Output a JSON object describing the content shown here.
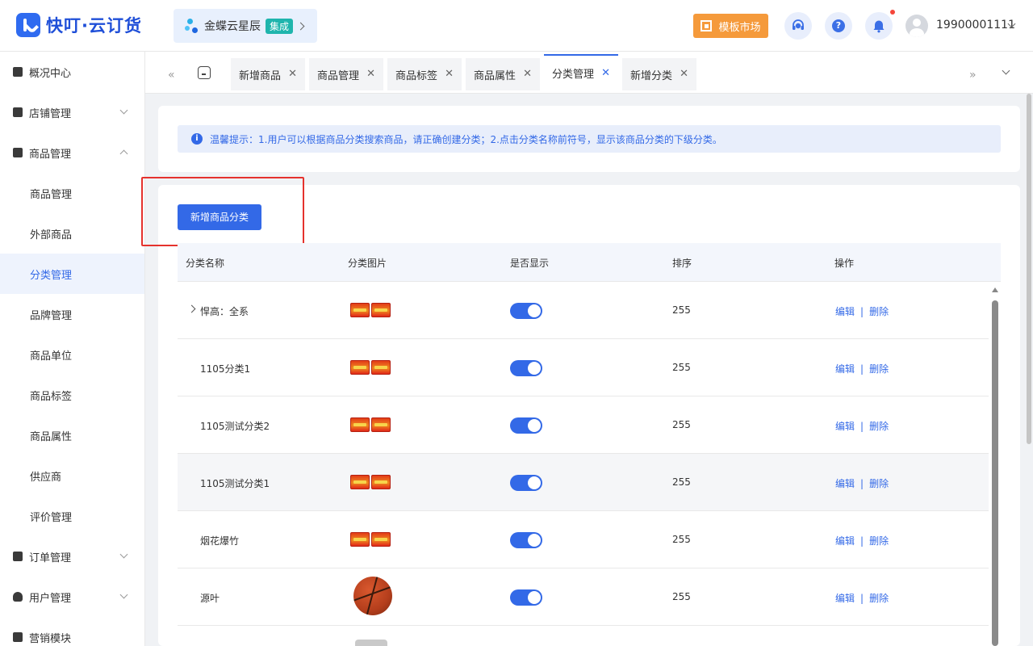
{
  "header": {
    "brand": "快叮·云订货",
    "integration": {
      "name": "金蝶云星辰",
      "badge": "集成"
    },
    "template_market": "模板市场",
    "user_phone": "19900001111",
    "icons": [
      "customer-service-icon",
      "help-icon",
      "bell-icon"
    ],
    "accent": "#3369e7",
    "orange": "#f59a3b"
  },
  "sidebar": {
    "items": [
      {
        "label": "概况中心",
        "level": 1,
        "icon": "dashboard-icon"
      },
      {
        "label": "店铺管理",
        "level": 1,
        "icon": "store-icon",
        "expandable": true,
        "expanded": false
      },
      {
        "label": "商品管理",
        "level": 1,
        "icon": "goods-icon",
        "expandable": true,
        "expanded": true
      },
      {
        "label": "商品管理",
        "level": 2
      },
      {
        "label": "外部商品",
        "level": 2
      },
      {
        "label": "分类管理",
        "level": 2,
        "active": true
      },
      {
        "label": "品牌管理",
        "level": 2
      },
      {
        "label": "商品单位",
        "level": 2
      },
      {
        "label": "商品标签",
        "level": 2
      },
      {
        "label": "商品属性",
        "level": 2
      },
      {
        "label": "供应商",
        "level": 2
      },
      {
        "label": "评价管理",
        "level": 2
      },
      {
        "label": "订单管理",
        "level": 1,
        "icon": "order-icon",
        "expandable": true,
        "expanded": false
      },
      {
        "label": "用户管理",
        "level": 1,
        "icon": "user-icon",
        "expandable": true,
        "expanded": false
      },
      {
        "label": "营销模块",
        "level": 1,
        "icon": "marketing-icon"
      }
    ]
  },
  "tabs": {
    "items": [
      {
        "label": "新增商品"
      },
      {
        "label": "商品管理"
      },
      {
        "label": "商品标签"
      },
      {
        "label": "商品属性"
      },
      {
        "label": "分类管理",
        "active": true
      },
      {
        "label": "新增分类"
      }
    ]
  },
  "notice": {
    "text": "温馨提示：1.用户可以根据商品分类搜索商品，请正确创建分类；2.点击分类名称前符号，显示该商品分类的下级分类。"
  },
  "actions": {
    "add_category": "新增商品分类"
  },
  "table": {
    "columns": [
      "分类名称",
      "分类图片",
      "是否显示",
      "排序",
      "操作"
    ],
    "edit_label": "编辑",
    "delete_label": "删除",
    "separator": "|",
    "rows": [
      {
        "name": "悍高：全系",
        "image": "firecracker",
        "visible": true,
        "sort": "255",
        "expandable": true
      },
      {
        "name": "1105分类1",
        "image": "firecracker",
        "visible": true,
        "sort": "255"
      },
      {
        "name": "1105测试分类2",
        "image": "firecracker",
        "visible": true,
        "sort": "255"
      },
      {
        "name": "1105测试分类1",
        "image": "firecracker",
        "visible": true,
        "sort": "255",
        "hover": true
      },
      {
        "name": "烟花爆竹",
        "image": "firecracker",
        "visible": true,
        "sort": "255"
      },
      {
        "name": "源叶",
        "image": "basketball",
        "visible": true,
        "sort": "255"
      }
    ]
  }
}
